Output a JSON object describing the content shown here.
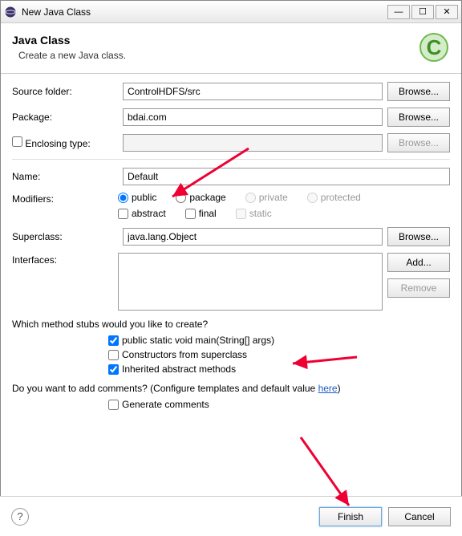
{
  "window": {
    "title": "New Java Class"
  },
  "header": {
    "title": "Java Class",
    "subtitle": "Create a new Java class."
  },
  "form": {
    "sourceFolderLabel": "Source folder:",
    "sourceFolder": "ControlHDFS/src",
    "packageLabel": "Package:",
    "package": "bdai.com",
    "enclosingTypeLabel": "Enclosing type:",
    "enclosingType": "",
    "nameLabel": "Name:",
    "name": "Default",
    "modifiersLabel": "Modifiers:",
    "modifiers": {
      "public": "public",
      "package": "package",
      "private": "private",
      "protected": "protected",
      "abstract": "abstract",
      "final": "final",
      "static": "static"
    },
    "superclassLabel": "Superclass:",
    "superclass": "java.lang.Object",
    "interfacesLabel": "Interfaces:"
  },
  "buttons": {
    "browse": "Browse...",
    "add": "Add...",
    "remove": "Remove",
    "finish": "Finish",
    "cancel": "Cancel"
  },
  "stubs": {
    "question": "Which method stubs would you like to create?",
    "main": "public static void main(String[] args)",
    "constructors": "Constructors from superclass",
    "inherited": "Inherited abstract methods"
  },
  "comments": {
    "question_pre": "Do you want to add comments? (Configure templates and default value ",
    "link": "here",
    "question_post": ")",
    "generate": "Generate comments"
  }
}
